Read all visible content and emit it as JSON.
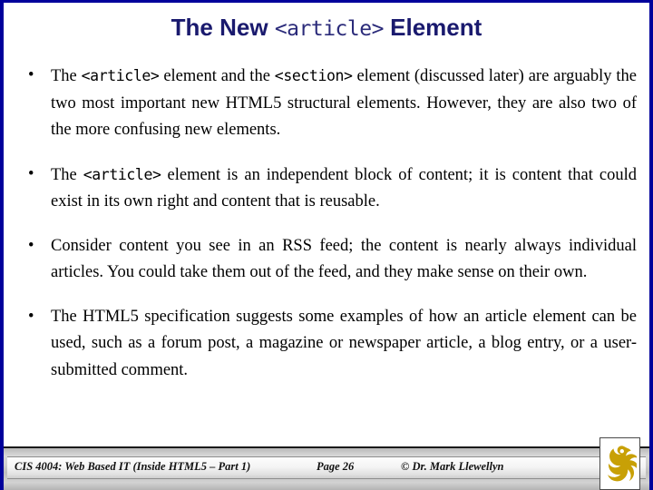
{
  "slide": {
    "border_color": "#00009B",
    "background": "#FFFFFF",
    "title": {
      "prefix": "The New ",
      "code": "<article>",
      "suffix": " Element",
      "color": "#1A1A6E"
    },
    "bullets": [
      {
        "marker": "•",
        "parts": [
          {
            "type": "text",
            "value": "The "
          },
          {
            "type": "code",
            "value": "<article>"
          },
          {
            "type": "text",
            "value": " element and the "
          },
          {
            "type": "code",
            "value": "<section>"
          },
          {
            "type": "text",
            "value": " element (discussed later) are arguably the two most important new HTML5 structural elements.  However, they are also two of the more confusing new elements."
          }
        ]
      },
      {
        "marker": "•",
        "parts": [
          {
            "type": "text",
            "value": "The "
          },
          {
            "type": "code",
            "value": "<article>"
          },
          {
            "type": "text",
            "value": " element is an independent block of content; it is content that could exist in its own right and content that is reusable."
          }
        ]
      },
      {
        "marker": "•",
        "parts": [
          {
            "type": "text",
            "value": "Consider content you see in an RSS feed; the content is nearly always individual articles.  You could take them out of the feed, and they make sense on their own."
          }
        ]
      },
      {
        "marker": "•",
        "parts": [
          {
            "type": "text",
            "value": "The HTML5 specification suggests some examples of how an article element can be used, such as a forum post, a magazine or newspaper article, a blog entry, or a user-submitted comment."
          }
        ]
      }
    ]
  },
  "footer": {
    "course": "CIS 4004: Web Based IT (Inside HTML5 – Part 1)",
    "page": "Page 26",
    "copyright": "© Dr. Mark Llewellyn",
    "logo_name": "ucf-pegasus-logo",
    "logo_color": "#C8A006"
  }
}
